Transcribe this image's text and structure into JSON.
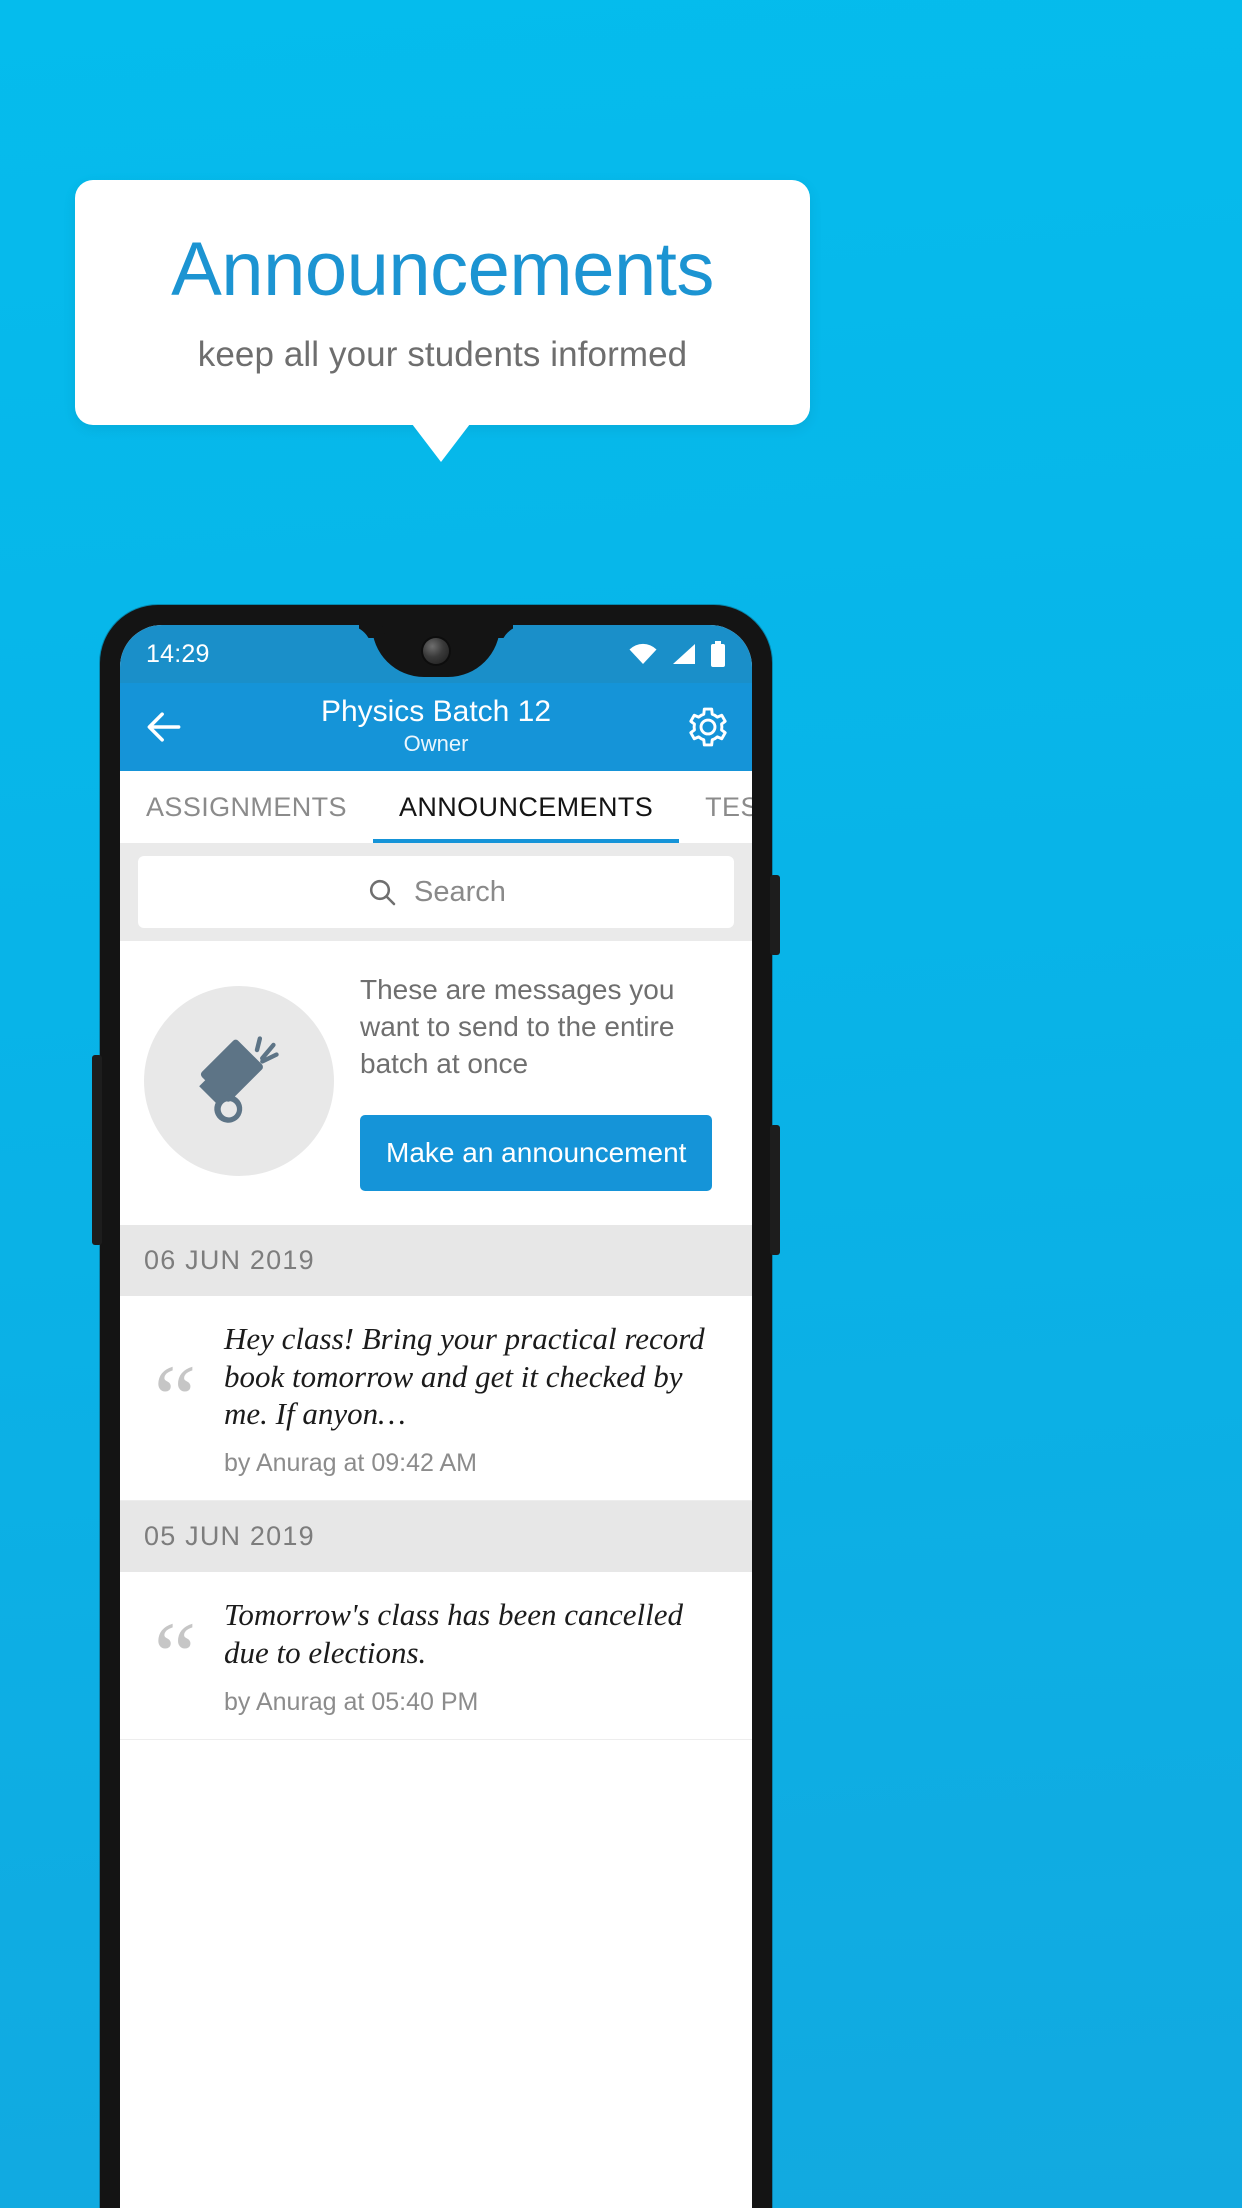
{
  "promo": {
    "title": "Announcements",
    "subtitle": "keep all your students informed",
    "title_color": "#1c94d2",
    "background_color": "#08b4e8"
  },
  "phone": {
    "status_bar": {
      "time": "14:29",
      "icons": [
        "wifi-icon",
        "signal-icon",
        "battery-icon"
      ],
      "background_color": "#1a8fc9"
    },
    "app_bar": {
      "back_icon": "back-arrow-icon",
      "title": "Physics Batch 12",
      "subtitle": "Owner",
      "settings_icon": "gear-icon",
      "background_color": "#1594d8"
    },
    "tabs": [
      {
        "label": "ASSIGNMENTS",
        "active": false
      },
      {
        "label": "ANNOUNCEMENTS",
        "active": true
      },
      {
        "label": "TESTS",
        "active": false
      }
    ],
    "search": {
      "icon": "search-icon",
      "placeholder": "Search",
      "value": ""
    },
    "empty_state": {
      "icon": "megaphone-icon",
      "text": "These are messages you want to send to the entire batch at once",
      "button_label": "Make an announcement",
      "button_color": "#1594d8"
    },
    "groups": [
      {
        "date": "06 JUN 2019",
        "items": [
          {
            "quote_icon": "quote-icon",
            "text": "Hey class! Bring your practical record book tomorrow and get it checked by me. If anyon…",
            "meta": "by Anurag at 09:42 AM"
          }
        ]
      },
      {
        "date": "05 JUN 2019",
        "items": [
          {
            "quote_icon": "quote-icon",
            "text": "Tomorrow's class has been cancelled due to elections.",
            "meta": "by Anurag at 05:40 PM"
          }
        ]
      }
    ]
  }
}
